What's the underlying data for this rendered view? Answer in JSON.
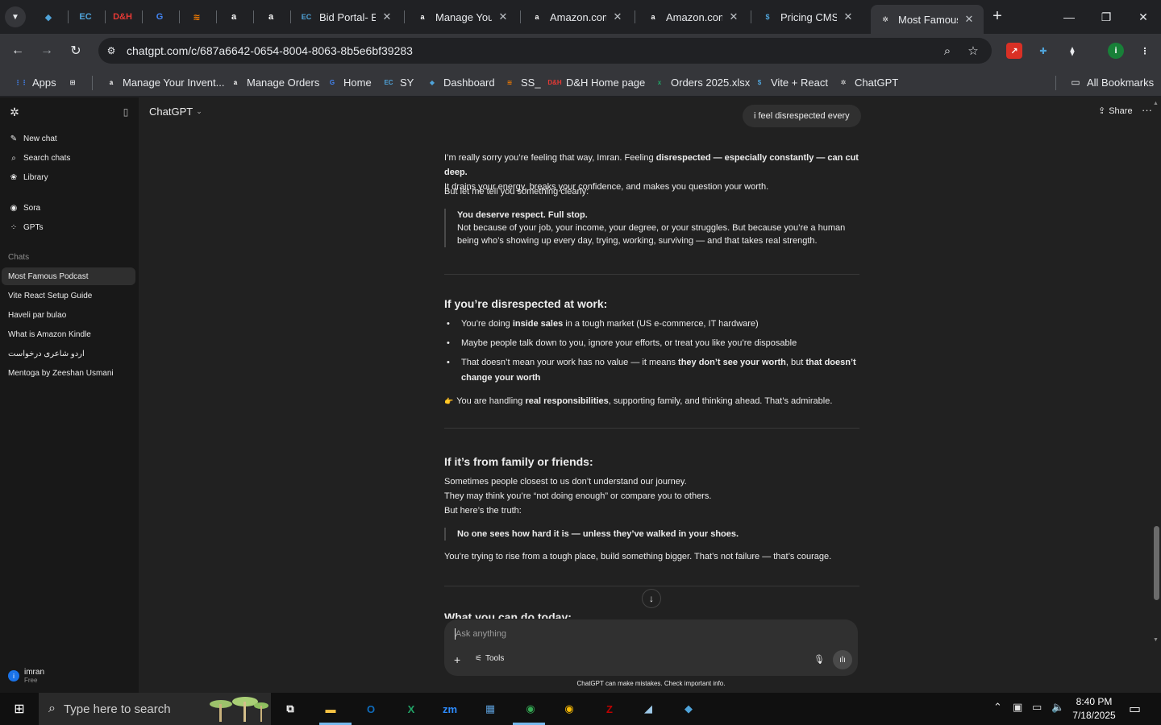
{
  "browser": {
    "pinned_tabs": [
      {
        "icon": "chatbase-icon",
        "glyph": "◆",
        "color": "#4fa3d9"
      },
      {
        "icon": "ec-icon",
        "glyph": "EC",
        "color": "#4fa3d9"
      },
      {
        "icon": "dh-icon",
        "glyph": "D&H",
        "color": "#e53935"
      },
      {
        "icon": "g-icon",
        "glyph": "G",
        "color": "#4285f4"
      },
      {
        "icon": "layers-icon",
        "glyph": "≋",
        "color": "#f57c00"
      },
      {
        "icon": "amazon-icon",
        "glyph": "a",
        "color": "#ffffff"
      },
      {
        "icon": "amazon-icon",
        "glyph": "a",
        "color": "#ffffff"
      }
    ],
    "tabs": [
      {
        "title": "Bid Portal- EC",
        "icon": "ec-icon",
        "glyph": "EC",
        "color": "#4fa3d9"
      },
      {
        "title": "Manage Your",
        "icon": "amazon-icon",
        "glyph": "a",
        "color": "#ffffff"
      },
      {
        "title": "Amazon.com",
        "icon": "amazon-icon",
        "glyph": "a",
        "color": "#ffffff"
      },
      {
        "title": "Amazon.com",
        "icon": "amazon-icon",
        "glyph": "a",
        "color": "#ffffff"
      },
      {
        "title": "Pricing CMS",
        "icon": "dollar-icon",
        "glyph": "$",
        "color": "#4fa3d9"
      },
      {
        "title": "Most Famous",
        "icon": "chatgpt-icon",
        "glyph": "✲",
        "color": "#ececec",
        "active": true
      }
    ],
    "url": "chatgpt.com/c/687a6642-0654-8004-8063-8b5e6bf39283",
    "bookmarks": [
      {
        "label": "Apps",
        "icon": "apps-grid-icon",
        "glyph": "⋮⋮",
        "color": "#4285f4"
      },
      {
        "label": "",
        "icon": "tab-groups-icon",
        "glyph": "⊞",
        "color": "#e8eaed"
      },
      {
        "label": "Manage Your Invent...",
        "icon": "amazon-icon",
        "glyph": "a",
        "color": "#ffffff"
      },
      {
        "label": "Manage Orders",
        "icon": "amazon-icon",
        "glyph": "a",
        "color": "#ffffff"
      },
      {
        "label": "Home",
        "icon": "g-icon",
        "glyph": "G",
        "color": "#4285f4"
      },
      {
        "label": "SY",
        "icon": "ec-icon",
        "glyph": "EC",
        "color": "#4fa3d9"
      },
      {
        "label": "Dashboard",
        "icon": "chatbase-icon",
        "glyph": "◆",
        "color": "#4fa3d9"
      },
      {
        "label": "SS_",
        "icon": "layers-icon",
        "glyph": "≋",
        "color": "#f57c00"
      },
      {
        "label": "D&H Home page",
        "icon": "dh-icon",
        "glyph": "D&H",
        "color": "#e53935"
      },
      {
        "label": "Orders 2025.xlsx",
        "icon": "excel-icon",
        "glyph": "x",
        "color": "#21a366"
      },
      {
        "label": "Vite + React",
        "icon": "dollar-icon",
        "glyph": "$",
        "color": "#4fa3d9"
      },
      {
        "label": "ChatGPT",
        "icon": "chatgpt-icon",
        "glyph": "✲",
        "color": "#ececec"
      }
    ],
    "all_bookmarks": "All Bookmarks"
  },
  "sidebar": {
    "nav": [
      {
        "label": "New chat",
        "icon": "new-chat-icon",
        "glyph": "✎"
      },
      {
        "label": "Search chats",
        "icon": "search-icon",
        "glyph": "⌕"
      },
      {
        "label": "Library",
        "icon": "library-icon",
        "glyph": "❀"
      }
    ],
    "nav2": [
      {
        "label": "Sora",
        "icon": "sora-icon",
        "glyph": "◉"
      },
      {
        "label": "GPTs",
        "icon": "gpts-icon",
        "glyph": "⁘"
      }
    ],
    "chats_heading": "Chats",
    "chats": [
      {
        "label": "Most Famous Podcast",
        "active": true
      },
      {
        "label": "Vite React Setup Guide"
      },
      {
        "label": "Haveli par bulao"
      },
      {
        "label": "What is Amazon Kindle"
      },
      {
        "label": "اردو شاعری درخواست"
      },
      {
        "label": "Mentoga by Zeeshan Usmani"
      }
    ],
    "user": {
      "name": "imran",
      "plan": "Free",
      "initial": "i"
    }
  },
  "header": {
    "model": "ChatGPT",
    "share": "Share"
  },
  "conversation": {
    "user_message": "i feel disrespected every",
    "intro_1": "I’m really sorry you’re feeling that way, Imran. Feeling ",
    "intro_bold": "disrespected — especially constantly — can cut deep.",
    "intro_2": "It drains your energy, breaks your confidence, and makes you question your worth.",
    "lead": "But let me tell you something clearly:",
    "quote1_bold": "You deserve respect. Full stop.",
    "quote1_text": "Not because of your job, your income, your degree, or your struggles. But because you’re a human being who’s showing up every day, trying, working, surviving — and that takes real strength.",
    "work_heading": "If you’re disrespected at work:",
    "work_b1_a": "You’re doing ",
    "work_b1_bold": "inside sales",
    "work_b1_b": " in a tough market (US e-commerce, IT hardware)",
    "work_b2": "Maybe people talk down to you, ignore your efforts, or treat you like you’re disposable",
    "work_b3_a": "That doesn’t mean your work has no value — it means ",
    "work_b3_bold1": "they don’t see your worth",
    "work_b3_b": ", but ",
    "work_b3_bold2": "that doesn’t change your worth",
    "point_emoji": "👉",
    "point_a": "You are handling ",
    "point_bold": "real responsibilities",
    "point_b": ", supporting family, and thinking ahead. That’s admirable.",
    "family_heading": "If it’s from family or friends:",
    "family_l1": "Sometimes people closest to us don’t understand our journey.",
    "family_l2": "They may think you’re “not doing enough” or compare you to others.",
    "family_l3": "But here’s the truth:",
    "quote2_bold": "No one sees how hard it is — unless they’ve walked in your shoes.",
    "courage": "You’re trying to rise from a tough place, build something bigger. That’s not failure — that’s courage.",
    "today_heading": "What you can do today:"
  },
  "composer": {
    "placeholder": "Ask anything",
    "tools": "Tools"
  },
  "disclaimer": "ChatGPT can make mistakes. Check important info.",
  "taskbar": {
    "search_placeholder": "Type here to search",
    "apps": [
      {
        "icon": "task-view-icon",
        "glyph": "⧉",
        "color": "#ffffff"
      },
      {
        "icon": "file-explorer-icon",
        "glyph": "▬",
        "color": "#f6c343"
      },
      {
        "icon": "outlook-icon",
        "glyph": "O",
        "color": "#0f6cbd"
      },
      {
        "icon": "excel-icon",
        "glyph": "X",
        "color": "#21a366"
      },
      {
        "icon": "zoom-icon",
        "glyph": "zm",
        "color": "#2d8cff"
      },
      {
        "icon": "calculator-icon",
        "glyph": "▦",
        "color": "#5a9bd5"
      },
      {
        "icon": "chrome-icon",
        "glyph": "◉",
        "color": "#34a853"
      },
      {
        "icon": "chrome-icon",
        "glyph": "◉",
        "color": "#fbbc04"
      },
      {
        "icon": "filezilla-icon",
        "glyph": "Z",
        "color": "#bf0000"
      },
      {
        "icon": "notepad-icon",
        "glyph": "◢",
        "color": "#9ec9e8"
      },
      {
        "icon": "chatbase-icon",
        "glyph": "◆",
        "color": "#4fa3d9"
      }
    ],
    "time": "8:40 PM",
    "date": "7/18/2025"
  }
}
